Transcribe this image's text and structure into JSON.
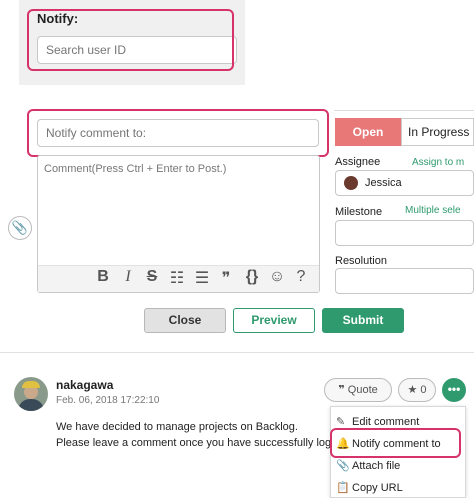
{
  "notify": {
    "label": "Notify:",
    "search_placeholder": "Search user ID"
  },
  "notify_comment": {
    "placeholder": "Notify comment to:"
  },
  "comment": {
    "placeholder": "Comment(Press Ctrl + Enter to Post.)",
    "toolbar": {
      "bold": "B",
      "italic": "I",
      "strike": "S",
      "bullet_list": "☷",
      "numbered_list": "☰",
      "quote": "❞",
      "code": "{}",
      "emoji": "☺",
      "help": "?"
    }
  },
  "status": {
    "open": "Open",
    "in_progress": "In Progress"
  },
  "assignee": {
    "label": "Assignee",
    "link": "Assign to m",
    "value": "Jessica"
  },
  "milestone": {
    "label": "Milestone",
    "link": "Multiple sele"
  },
  "resolution": {
    "label": "Resolution"
  },
  "buttons": {
    "close": "Close",
    "preview": "Preview",
    "submit": "Submit"
  },
  "post": {
    "user": "nakagawa",
    "date": "Feb. 06, 2018 17:22:10",
    "message_lines": [
      "We have decided to manage projects on Backlog.",
      "Please leave a comment once you have successfully logged"
    ],
    "quote_label": "Quote",
    "star_count": "0"
  },
  "menu": {
    "items": [
      {
        "icon": "pencil-icon",
        "label": "Edit comment"
      },
      {
        "icon": "bell-icon",
        "label": "Notify comment to"
      },
      {
        "icon": "paperclip-icon",
        "label": "Attach file"
      },
      {
        "icon": "clipboard-icon",
        "label": "Copy URL"
      }
    ]
  },
  "colors": {
    "highlight": "#d6336c",
    "accent_green": "#2e9a6e",
    "status_open": "#e87878"
  }
}
